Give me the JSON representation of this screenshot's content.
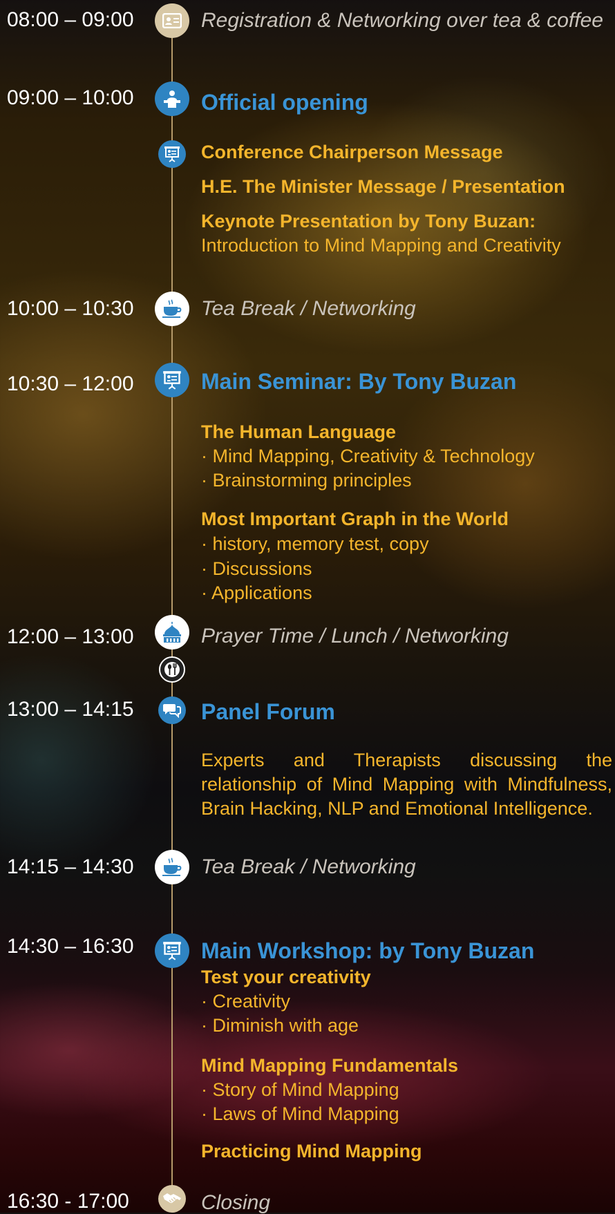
{
  "colors": {
    "blue_accent": "#3a94d6",
    "gold_text": "#f4b52c",
    "muted_text": "#c9c3bb",
    "line": "#b59a6a"
  },
  "sessions": {
    "registration": {
      "time": "08:00 – 09:00",
      "title": "Registration & Networking over tea & coffee",
      "icon": "id-card-icon"
    },
    "opening": {
      "time": "09:00 – 10:00",
      "title": "Official opening",
      "icon": "speaker-podium-icon",
      "sub_icon": "presentation-board-icon",
      "items": [
        "Conference Chairperson Message",
        "H.E. The Minister Message / Presentation",
        "Keynote Presentation by Tony Buzan:"
      ],
      "keynote_subtitle": "Introduction to Mind Mapping and Creativity"
    },
    "tea_break_1": {
      "time": "10:00 – 10:30",
      "title": "Tea Break / Networking",
      "icon": "tea-cup-icon"
    },
    "seminar": {
      "time": "10:30 – 12:00",
      "title": "Main Seminar: By Tony Buzan",
      "icon": "presentation-board-icon",
      "groups": [
        {
          "heading": "The Human Language",
          "points": [
            "· Mind Mapping, Creativity & Technology",
            "· Brainstorming principles"
          ]
        },
        {
          "heading": "Most Important Graph in the World",
          "points": [
            "· history, memory test, copy",
            "· Discussions",
            "· Applications"
          ]
        }
      ]
    },
    "lunch": {
      "time": "12:00 – 13:00",
      "title": "Prayer Time  / Lunch  / Networking",
      "icon": "mosque-icon",
      "sub_icon": "fork-spoon-icon"
    },
    "panel": {
      "time": "13:00 – 14:15",
      "title": "Panel Forum",
      "icon": "chat-bubbles-icon",
      "description_lines": [
        "Experts and Therapists discussing the",
        "relationship of Mind Mapping with Mindfulness,",
        "Brain Hacking, NLP and Emotional Intelligence."
      ]
    },
    "tea_break_2": {
      "time": "14:15 – 14:30",
      "title": "Tea Break / Networking",
      "icon": "tea-cup-icon"
    },
    "workshop": {
      "time": "14:30 – 16:30",
      "title": "Main Workshop: by Tony Buzan",
      "icon": "presentation-board-icon",
      "groups": [
        {
          "heading": "Test your creativity",
          "points": [
            "· Creativity",
            "· Diminish with age"
          ]
        },
        {
          "heading": "Mind Mapping Fundamentals",
          "points": [
            "· Story of Mind Mapping",
            "· Laws of Mind Mapping"
          ]
        },
        {
          "heading": "Practicing Mind Mapping",
          "points": []
        }
      ]
    },
    "closing": {
      "time": "16:30 - 17:00",
      "title": "Closing",
      "icon": "handshake-icon"
    }
  }
}
